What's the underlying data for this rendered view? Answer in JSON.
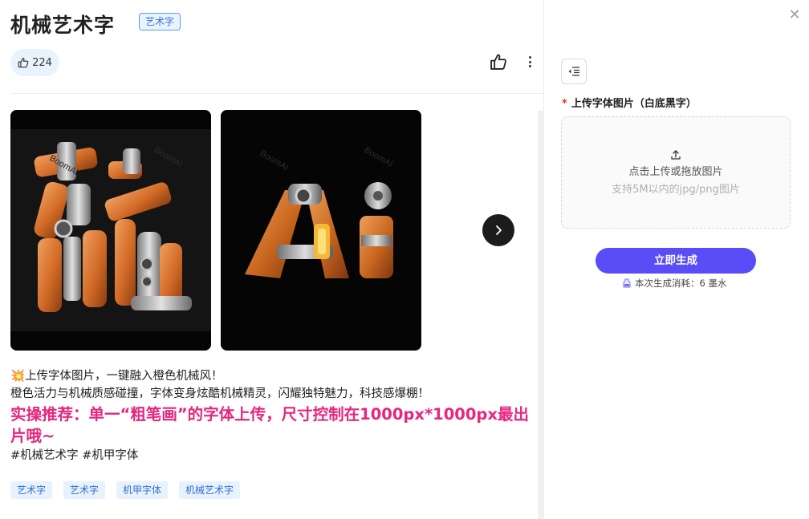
{
  "header": {
    "title": "机械艺术字",
    "category_tag": "艺术字",
    "close_icon": "close-icon"
  },
  "actions": {
    "like_count": "224",
    "like_icon": "thumb-up-icon",
    "more_icon": "more-vertical-icon"
  },
  "gallery": {
    "images": [
      {
        "name": "龍 mechanical orange metal lettering",
        "watermark": "BoomAI"
      },
      {
        "name": "Ai mechanical orange metal lettering",
        "watermark": "BoomAI"
      }
    ],
    "next_icon": "chevron-right-icon"
  },
  "description": {
    "line1_emoji": "💥",
    "line1": "上传字体图片，一键融入橙色机械风！",
    "line2": "橙色活力与机械质感碰撞，字体变身炫酷机械精灵，闪耀独特魅力，科技感爆棚！",
    "highlight": "实操推荐：单一“粗笔画”的字体上传，尺寸控制在1000px*1000px最出片哦~",
    "hashtags": "#机械艺术字 #机甲字体"
  },
  "tags": [
    "艺术字",
    "艺术字",
    "机甲字体",
    "机械艺术字"
  ],
  "panel": {
    "collapse_icon": "collapse-menu-icon",
    "upload_required_mark": "*",
    "upload_label": "上传字体图片（白底黑字）",
    "upload_icon": "upload-icon",
    "upload_text": "点击上传或拖放图片",
    "upload_hint": "支持5M以内的jpg/png图片",
    "generate_label": "立即生成",
    "cost_icon": "ink-bottle-icon",
    "cost_text": "本次生成消耗：6 墨水"
  },
  "colors": {
    "accent": "#5a4cf6",
    "highlight_pink": "#e6267f",
    "tag_blue": "#2f6fd6",
    "mech_orange": "#d9782f"
  }
}
